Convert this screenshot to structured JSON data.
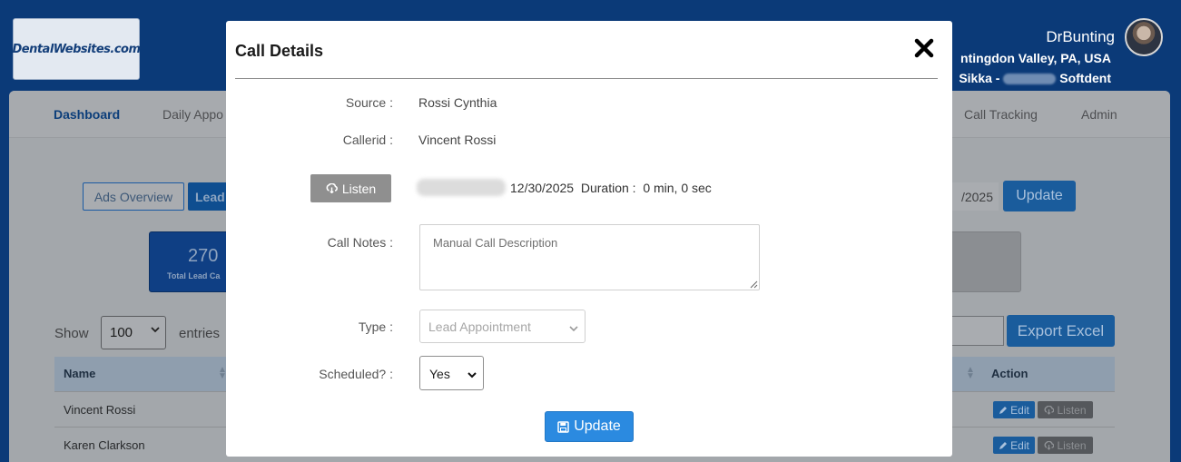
{
  "app": {
    "logo_text": "DentalWebsites.com",
    "user": {
      "name": "DrBunting",
      "location": "ntingdon Valley, PA, USA",
      "pms_prefix": "Sikka -",
      "pms_suffix": "Softdent"
    }
  },
  "nav": {
    "items": [
      {
        "label": "Dashboard",
        "active": true
      },
      {
        "label": "Daily Appo",
        "active": false
      },
      {
        "label": "Call Tracking",
        "active": false
      },
      {
        "label": "Admin",
        "active": false
      }
    ]
  },
  "toolbar": {
    "tab_ads": "Ads Overview",
    "tab_lead": "Lead",
    "date_fragment": "/2025",
    "update_label": "Update"
  },
  "stat": {
    "value": "270",
    "label": "Total Lead Ca"
  },
  "table_controls": {
    "show_label": "Show",
    "entries_value": "100",
    "entries_label": "entries",
    "export_label": "Export Excel"
  },
  "table": {
    "col_name": "Name",
    "col_action": "Action",
    "rows": [
      {
        "name": "Vincent Rossi",
        "edit": "Edit",
        "listen": "Listen"
      },
      {
        "name": "Karen Clarkson",
        "edit": "Edit",
        "listen": "Listen"
      }
    ]
  },
  "modal": {
    "title": "Call Details",
    "source_label": "Source :",
    "source_value": "Rossi Cynthia",
    "callerid_label": "Callerid :",
    "callerid_value": "Vincent Rossi",
    "listen_label": "Listen",
    "call_meta": "12/30/2025  Duration :  0 min, 0 sec",
    "notes_label": "Call Notes :",
    "notes_placeholder": "Manual Call Description",
    "type_label": "Type :",
    "type_value": "Lead Appointment",
    "scheduled_label": "Scheduled? :",
    "scheduled_value": "Yes",
    "update_label": "Update"
  },
  "colors": {
    "brand_navy": "#0b3a78",
    "update_blue": "#2b8ae0",
    "listen_gray": "#8f8f8f"
  },
  "icons": {
    "close": "close-icon",
    "listen": "cloud-download-icon",
    "update": "save-icon",
    "edit": "pencil-icon",
    "select": "chevron-down-icon"
  }
}
